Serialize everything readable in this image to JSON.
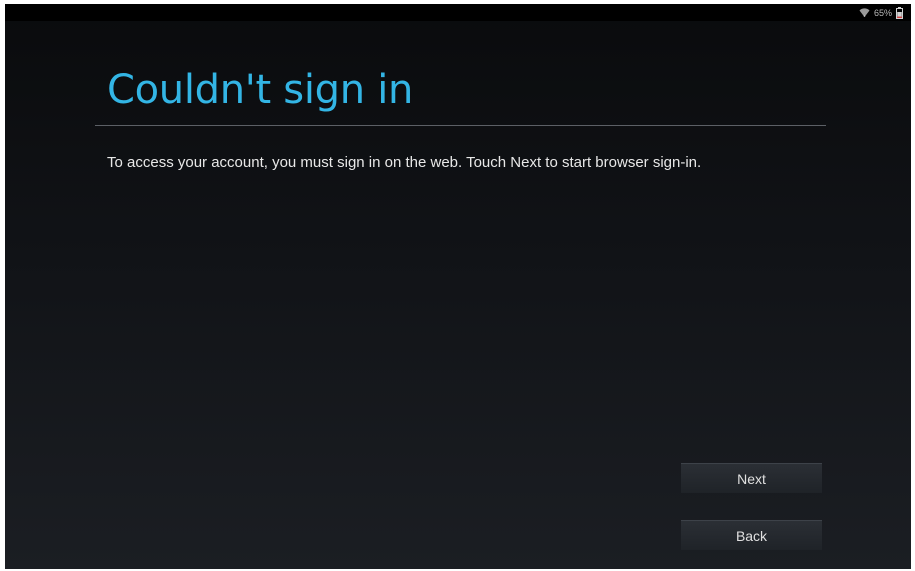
{
  "status_bar": {
    "icons": [
      "wifi-icon",
      "battery-icon"
    ],
    "battery_text": "65%"
  },
  "dialog": {
    "title": "Couldn't sign in",
    "message": "To access your account, you must sign in on the web. Touch Next to start browser sign-in."
  },
  "buttons": {
    "next_label": "Next",
    "back_label": "Back"
  },
  "colors": {
    "accent": "#33b5e5",
    "background_top": "#0a0b0d",
    "background_bottom": "#1b1e23",
    "text": "#e8e8e8"
  }
}
